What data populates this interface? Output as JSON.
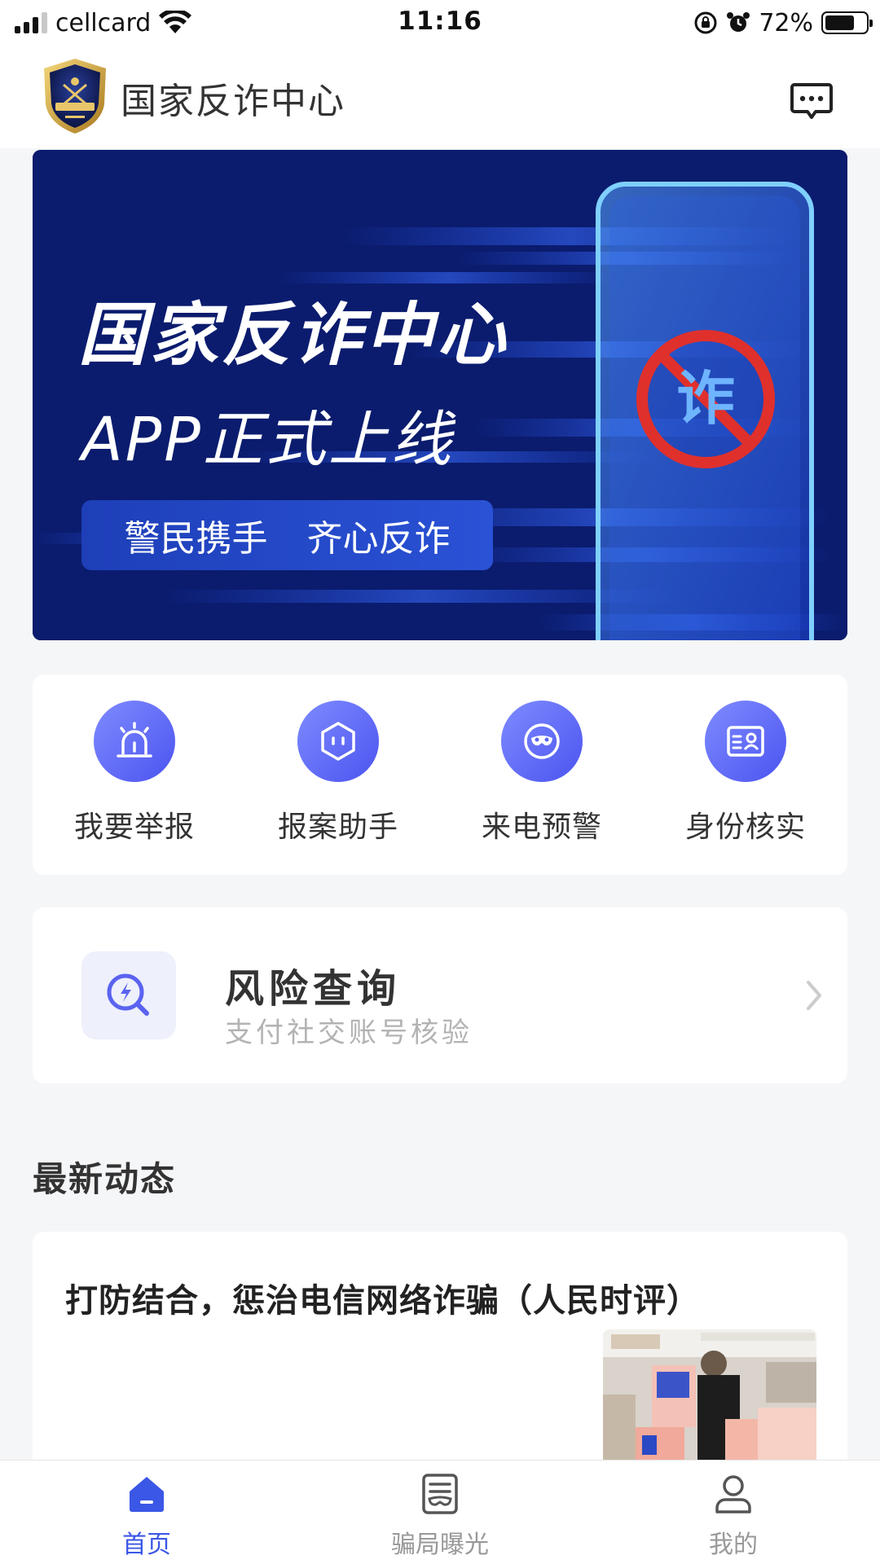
{
  "status_bar": {
    "carrier": "cellcard",
    "time": "11:16",
    "battery_percent": "72%",
    "battery_level": 0.72
  },
  "header": {
    "title": "国家反诈中心",
    "logo_icon": "police-badge-icon",
    "message_icon": "message-icon"
  },
  "banner": {
    "title": "国家反诈中心",
    "subtitle": "APP正式上线",
    "slogan_left": "警民携手",
    "slogan_right": "齐心反诈",
    "phone_badge": "诈"
  },
  "quick_actions": [
    {
      "label": "我要举报",
      "icon": "alarm-siren-icon"
    },
    {
      "label": "报案助手",
      "icon": "assistant-hexagon-icon"
    },
    {
      "label": "来电预警",
      "icon": "mask-icon"
    },
    {
      "label": "身份核实",
      "icon": "id-card-icon"
    }
  ],
  "risk_query": {
    "title": "风险查询",
    "subtitle": "支付社交账号核验",
    "icon": "search-lightning-icon"
  },
  "news": {
    "heading": "最新动态",
    "items": [
      {
        "title": "打防结合，惩治电信网络诈骗（人民时评）"
      }
    ]
  },
  "tab_bar": {
    "items": [
      {
        "label": "首页",
        "icon": "home-icon",
        "active": true
      },
      {
        "label": "骗局曝光",
        "icon": "exposure-icon",
        "active": false
      },
      {
        "label": "我的",
        "icon": "user-icon",
        "active": false
      }
    ]
  },
  "colors": {
    "accent": "#3b57e6",
    "icon_gradient_start": "#7f8bff",
    "icon_gradient_end": "#4b54f0",
    "banner_bg": "#0c1f78"
  }
}
